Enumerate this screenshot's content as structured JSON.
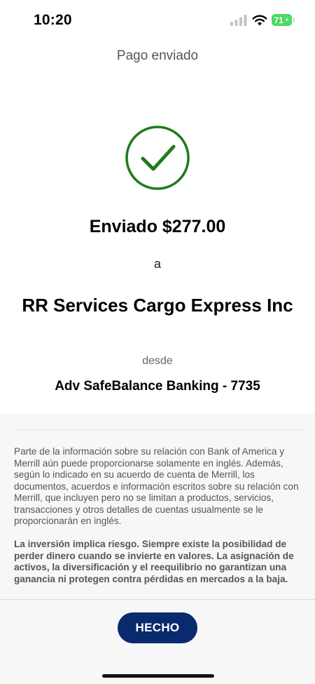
{
  "status_bar": {
    "time": "10:20",
    "battery_level": "71",
    "battery_color": "#4cd964"
  },
  "header": {
    "title": "Pago enviado"
  },
  "confirmation": {
    "status_icon": "check-circle-icon",
    "icon_color": "#1f7a1f",
    "sent_label": "Enviado $277.00",
    "to_label": "a",
    "recipient": "RR Services Cargo Express Inc",
    "from_label": "desde",
    "account": "Adv SafeBalance Banking - 7735"
  },
  "disclosure": {
    "language_notice": "Parte de la información sobre su relación con Bank of America y Merrill aún puede proporcionarse solamente en inglés. Además, según lo indicado en su acuerdo de cuenta de Merrill, los documentos, acuerdos e información escritos sobre su relación con Merrill, que incluyen pero no se limitan a productos, servicios, transacciones y otros detalles de cuentas usualmente se le proporcionarán en inglés.",
    "risk_notice": "La inversión implica riesgo. Siempre existe la posibilidad de perder dinero cuando se invierte en valores. La asignación de activos, la diversificación y el reequilibrio no garantizan una ganancia ni protegen contra pérdidas en mercados a la baja."
  },
  "footer": {
    "done_label": "HECHO",
    "button_color": "#0a2a6e"
  }
}
